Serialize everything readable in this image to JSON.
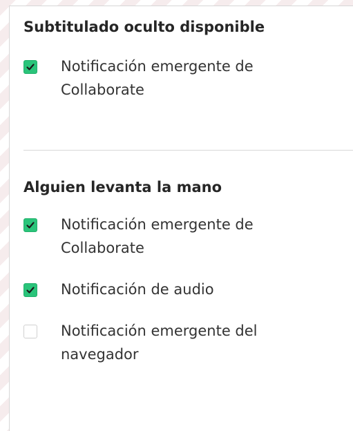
{
  "sections": [
    {
      "title": "Subtitulado oculto disponible",
      "options": [
        {
          "label": "Notificación emergente de Collaborate",
          "checked": true
        }
      ]
    },
    {
      "title": "Alguien levanta la mano",
      "options": [
        {
          "label": "Notificación emergente de Collaborate",
          "checked": true
        },
        {
          "label": "Notificación de audio",
          "checked": true
        },
        {
          "label": "Notificación emergente del navegador",
          "checked": false
        }
      ]
    }
  ],
  "colors": {
    "checkbox_checked": "#2ac47a",
    "background_stripe": "#f6eced"
  },
  "icons": {
    "checked": "checkmark-icon"
  }
}
